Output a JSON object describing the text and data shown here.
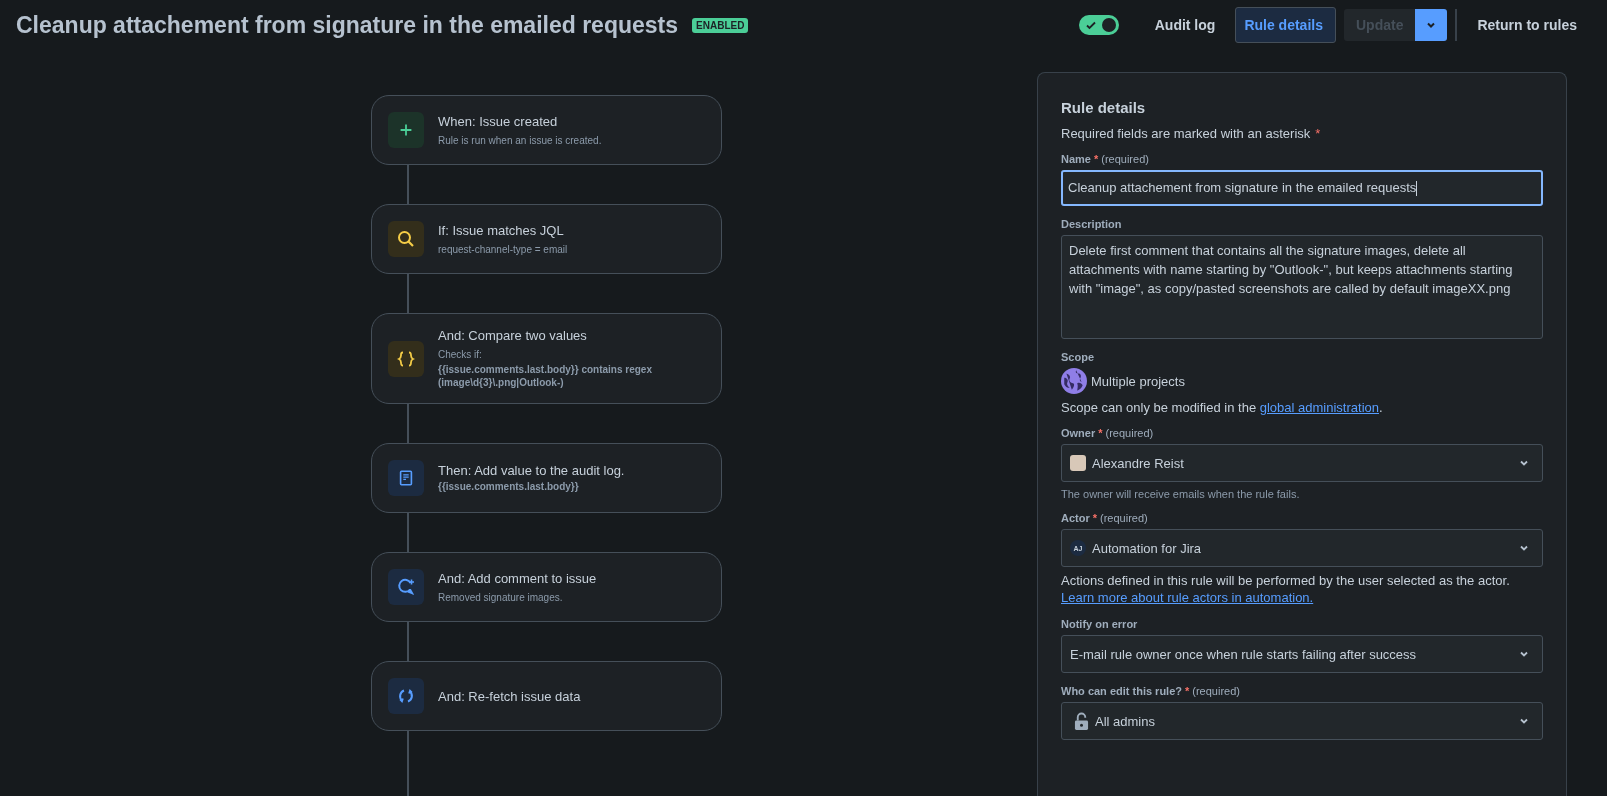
{
  "header": {
    "title": "Cleanup attachement from signature in the emailed requests",
    "badge": "ENABLED",
    "toggle": {
      "on": true
    },
    "nav": [
      {
        "label": "Audit log",
        "selected": false
      },
      {
        "label": "Rule details",
        "selected": true
      }
    ],
    "update": {
      "label": "Update",
      "disabled": true
    },
    "return_label": "Return to rules"
  },
  "steps": [
    {
      "kind": "trigger",
      "title": "When: Issue created",
      "lines": [
        {
          "text": "Rule is run when an issue is created.",
          "bold": false
        }
      ]
    },
    {
      "kind": "condition",
      "title": "If: Issue matches JQL",
      "lines": [
        {
          "text": "request-channel-type = email",
          "bold": false
        }
      ]
    },
    {
      "kind": "compare",
      "title": "And: Compare two values",
      "lines": [
        {
          "text": "Checks if:",
          "bold": false
        },
        {
          "text": "{{issue.comments.last.body}} contains regex (image\\d{3}\\.png|Outlook-)",
          "bold": true
        }
      ]
    },
    {
      "kind": "log",
      "title": "Then: Add value to the audit log.",
      "lines": [
        {
          "text": "{{issue.comments.last.body}}",
          "bold": true
        }
      ]
    },
    {
      "kind": "comment",
      "title": "And: Add comment to issue",
      "lines": [
        {
          "text": "Removed signature images.",
          "bold": false
        }
      ]
    },
    {
      "kind": "refetch",
      "title": "And: Re-fetch issue data"
    }
  ],
  "panel": {
    "title": "Rule details",
    "required_hint": "Required fields are marked with an asterisk",
    "required_mark": "*",
    "fields": [
      {
        "kind": "text",
        "label": "Name",
        "mark": "*",
        "note": "(required)",
        "value": "Cleanup attachement from signature in the emailed requests",
        "focused": true
      },
      {
        "kind": "textarea",
        "label": "Description",
        "value": "Delete first comment that contains all the signature images, delete all attachments with name starting by \"Outlook-\", but keeps attachments starting with \"image\", as copy/pasted screenshots are called by default imageXX.png",
        "focused": false
      },
      {
        "kind": "scope",
        "label": "Scope",
        "value": "Multiple projects",
        "text": "Scope can only be modified in the ",
        "link": "global administration",
        "note_end": "."
      },
      {
        "kind": "select",
        "label": "Owner",
        "mark": "*",
        "note": "(required)",
        "avatar": {
          "kind": "photo"
        },
        "value": "Alexandre Reist",
        "help": "The owner will receive emails when the rule fails.",
        "help_muted": true
      },
      {
        "kind": "select",
        "label": "Actor",
        "mark": "*",
        "note": "(required)",
        "avatar": {
          "kind": "initials",
          "initials": "AJ"
        },
        "value": "Automation for Jira",
        "help": "Actions defined in this rule will be performed by the user selected as the actor.",
        "help_muted": false,
        "help_link": "Learn more about rule actors in automation."
      },
      {
        "kind": "select",
        "label": "Notify on error",
        "value": "E-mail rule owner once when rule starts failing after success"
      },
      {
        "kind": "select",
        "label": "Who can edit this rule?",
        "mark": "*",
        "note": "(required)",
        "avatar": {
          "kind": "lock"
        },
        "value": "All admins"
      }
    ]
  }
}
